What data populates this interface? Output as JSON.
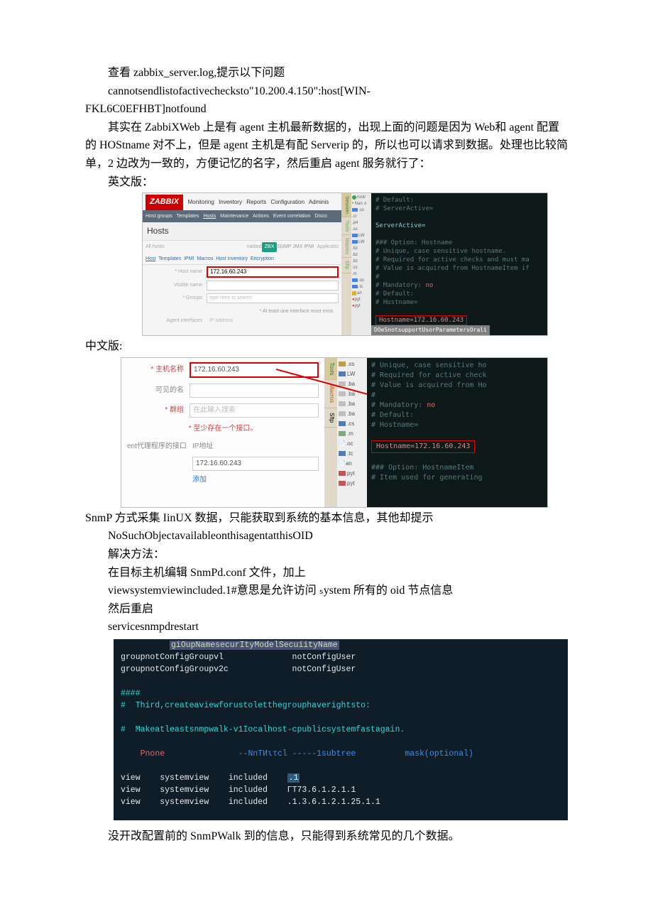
{
  "para1a": "查看 zabbix_server.log,提示以下问题",
  "para1b": "cannotsendlistofactivechecksto\"10.200.4.150\":host[WIN-",
  "para1c": "FKL6C0EFHBT]notfound",
  "para2": "其实在 ZabbiXWeb 上是有 agent 主机最新数据的，出现上面的问题是因为 Web和 agent 配置的 HOStname 对不上，但是 agent 主机是有配 Serverip 的，所以也可以请求到数据。处理也比较简单，2 边改为一致的，方便记忆的名字，然后重启 agent 服务就行了：",
  "para3": "英文版：",
  "para_zh_label": "中文版:",
  "para_snmp_intro": "SnmP 方式采集 IinUX 数据，只能获取到系统的基本信息，其他却提示",
  "para_snmp_err": "NoSuchObjectavailableonthisagentatthisOID",
  "para_sol1": "解决方法：",
  "para_sol2": "在目标主机编辑 SnmPd.conf 文件，加上",
  "para_sol3": "viewsystemviewincluded.1#意思是允许访问 ₛystem 所有的 oid 节点信息",
  "para_sol4": "然后重启",
  "para_sol5": "servicesnmpdrestart",
  "para_footer": "没开改配置前的 SnmPWalk 到的信息，只能得到系统常见的几个数据。",
  "img1": {
    "logo": "ZABBIX",
    "nav": [
      "Monitoring",
      "Inventory",
      "Reports",
      "Configuration",
      "Adminis"
    ],
    "subnav": [
      "Host groups",
      "Templates",
      "Hosts",
      "Maintenance",
      "Actions",
      "Event correlation",
      "Disco"
    ],
    "hosts_title": "Hosts",
    "allhosts": "All hosts",
    "enabled": "nabled",
    "zbx_badge": "ZBX",
    "applic": "Applicatio",
    "hosttabs": [
      "Host",
      "Templates",
      "IPMI",
      "Macros",
      "Host inventory",
      "Encryption"
    ],
    "label_hostname": "* Host name",
    "val_hostname": "172.16.60.243",
    "label_visible": "Visible name",
    "label_groups": "* Groups",
    "ph_groups": "type here to search",
    "note": "* At least one interface must exist.",
    "agentif": "Agent interfaces",
    "agentif_ph": "IP address",
    "side_tabs": [
      "Session",
      "Tools",
      "Macros",
      "Sftp"
    ],
    "tree": [
      "root/",
      ".us",
      ".cr",
      ".p4",
      ".ss",
      "LW",
      "LW",
      ".bz",
      ".bz",
      ".bz",
      ".cs",
      ".m",
      ".oc",
      ".tc",
      "an",
      "pyt",
      "pyt"
    ],
    "cfg": {
      "l1": "# Default:",
      "l2": "# ServerActive=",
      "l3": "ServerActive=",
      "l4": "### Option: Hostname",
      "l5_1": "#       Unique, case sensitive hostname.",
      "l5_2": "#       Required for active checks and must ma",
      "l5_3": "#       Value is acquired from HostnameItem if",
      "l6": "#",
      "l7": "# Mandatory: ",
      "l7_no": "no",
      "l8": "# Default:",
      "l9": "# Hostname=",
      "l10": "Hostname=172.16.60.243",
      "l11": "### Option: HostnameItem",
      "l12": "#       Item used for generating Hostname if i",
      "bottom": "DOeSnotsupportUsorParametersOrali"
    }
  },
  "img2": {
    "label_hostname": "主机名称",
    "val_hostname": "172.16.60.243",
    "label_visible": "可见的名",
    "label_groups": "群组",
    "ph_groups": "在此输入搜索",
    "note": "* 至少存在一个接口。",
    "sec_label": "ent代理程序的接口",
    "ip_header": "IP地址",
    "ip_val": "172.16.60.243",
    "add": "添加",
    "side_tabs": [
      "Tools",
      "Macros",
      "Sftp"
    ],
    "tree": [
      ".ss",
      "LW",
      ".ba",
      ".ba",
      ".ba",
      ".ba",
      ".cs",
      ".m",
      ".oc",
      ".tc",
      "an",
      "pyt",
      "pyt"
    ],
    "cfg": {
      "l1": "#       Unique, case sensitive ho",
      "l2": "#       Required for active check",
      "l3": "#       Value is acquired from Ho",
      "l4": "#",
      "l5": "# Mandatory: ",
      "l5_no": "no",
      "l6": "# Default:",
      "l7": "# Hostname=",
      "l8": "Hostname=172.16.60.243",
      "l9": "### Option: HostnameItem",
      "l10": "#       Item used for generating"
    }
  },
  "term3": {
    "header": "giOupNamesecurItyModelSecuiityName",
    "l1": "groupnotConfigGroupvl              notConfigUser",
    "l2": "groupnotConfigGroupv2c             notConfigUser",
    "l3": "####",
    "l4": "#  Third,createaviewforustoletthegrouphaverightsto:",
    "l5": "#  Makeatleastsnmpwalk-v1Iocalhost-cpublicsystemfastagain.",
    "l6_a": "Pnone",
    "l6_b": "--NnTИιτcl -----1subtree",
    "l6_c": "mask(optional)",
    "r1a": "view",
    "r1b": "systemview",
    "r1c": "included",
    "r1d": ".1",
    "r2a": "view",
    "r2b": "systemview",
    "r2c": "included",
    "r2d": "ΓT73.6.1.2.1.1",
    "r3a": "view",
    "r3b": "systemview",
    "r3c": "included",
    "r3d": ".1.3.6.1.2.1.25.1.1"
  }
}
